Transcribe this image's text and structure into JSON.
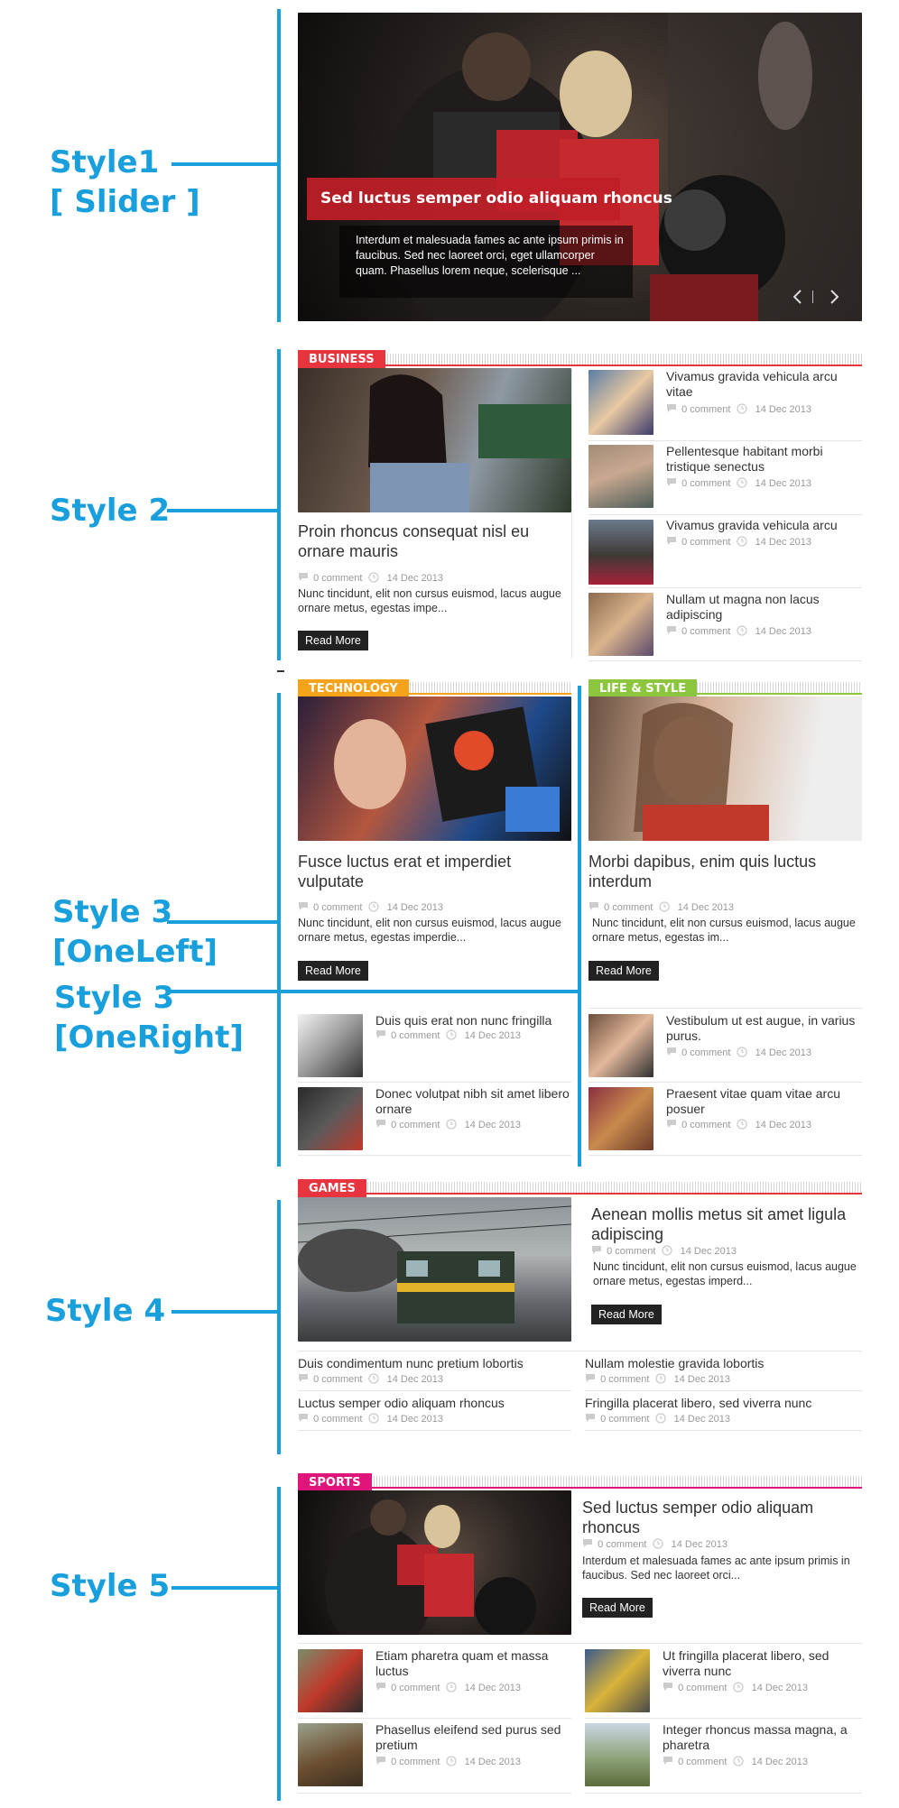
{
  "annotations": {
    "style1_line1": "Style1",
    "style1_line2": "[ Slider ]",
    "style2": "Style 2",
    "style3_left_1": "Style 3",
    "style3_left_2": "[OneLeft]",
    "style3_right_1": "Style 3",
    "style3_right_2": "[OneRight]",
    "style4": "Style 4",
    "style5": "Style 5"
  },
  "colors": {
    "annotation": "#19a0dc",
    "business": "#e8343f",
    "technology": "#f5a31a",
    "life_style": "#8cc63f",
    "games": "#e8343f",
    "sports": "#e0157b"
  },
  "slider": {
    "title": "Sed luctus semper odio aliquam rhoncus",
    "excerpt": "Interdum et malesuada fames ac ante ipsum primis in faucibus. Sed nec laoreet orci, eget ullamcorper quam. Phasellus lorem neque, scelerisque ...",
    "prev_icon": "chevron-left-icon",
    "next_icon": "chevron-right-icon"
  },
  "business": {
    "tag": "BUSINESS",
    "main": {
      "title": "Proin rhoncus consequat nisl eu ornare mauris",
      "comments": "0 comment",
      "date": "14 Dec 2013",
      "excerpt": "Nunc tincidunt, elit non cursus euismod, lacus augue ornare metus, egestas impe...",
      "read_more": "Read More"
    },
    "list": [
      {
        "title": "Vivamus gravida vehicula arcu vitae",
        "comments": "0 comment",
        "date": "14 Dec 2013"
      },
      {
        "title": "Pellentesque habitant morbi tristique senectus",
        "comments": "0 comment",
        "date": "14 Dec 2013"
      },
      {
        "title": "Vivamus gravida vehicula arcu",
        "comments": "0 comment",
        "date": "14 Dec 2013"
      },
      {
        "title": "Nullam ut magna non lacus adipiscing",
        "comments": "0 comment",
        "date": "14 Dec 2013"
      }
    ]
  },
  "technology": {
    "tag": "TECHNOLOGY",
    "main": {
      "title": "Fusce luctus erat et imperdiet vulputate",
      "comments": "0 comment",
      "date": "14 Dec 2013",
      "excerpt": "Nunc tincidunt, elit non cursus euismod, lacus augue ornare metus, egestas imperdie...",
      "read_more": "Read More"
    },
    "list": [
      {
        "title": "Duis quis erat non nunc fringilla",
        "comments": "0 comment",
        "date": "14 Dec 2013"
      },
      {
        "title": "Donec volutpat nibh sit amet libero ornare",
        "comments": "0 comment",
        "date": "14 Dec 2013"
      }
    ]
  },
  "life_style": {
    "tag": "LIFE & STYLE",
    "main": {
      "title": "Morbi dapibus, enim quis luctus interdum",
      "comments": "0 comment",
      "date": "14 Dec 2013",
      "excerpt": "Nunc tincidunt, elit non cursus euismod, lacus augue ornare metus, egestas im...",
      "read_more": "Read More"
    },
    "list": [
      {
        "title": "Vestibulum ut est augue, in varius purus.",
        "comments": "0 comment",
        "date": "14 Dec 2013"
      },
      {
        "title": "Praesent vitae quam vitae arcu posuer",
        "comments": "0 comment",
        "date": "14 Dec 2013"
      }
    ]
  },
  "games": {
    "tag": "GAMES",
    "main": {
      "title": "Aenean mollis metus sit amet ligula adipiscing",
      "comments": "0 comment",
      "date": "14 Dec 2013",
      "excerpt": "Nunc tincidunt, elit non cursus euismod, lacus augue ornare metus, egestas imperd...",
      "read_more": "Read More"
    },
    "list": [
      {
        "title": "Duis condimentum nunc pretium lobortis",
        "comments": "0 comment",
        "date": "14 Dec 2013"
      },
      {
        "title": "Nullam molestie gravida lobortis",
        "comments": "0 comment",
        "date": "14 Dec 2013"
      },
      {
        "title": "Luctus semper odio aliquam rhoncus",
        "comments": "0 comment",
        "date": "14 Dec 2013"
      },
      {
        "title": "Fringilla placerat libero, sed viverra nunc",
        "comments": "0 comment",
        "date": "14 Dec 2013"
      }
    ]
  },
  "sports": {
    "tag": "SPORTS",
    "main": {
      "title": "Sed luctus semper odio aliquam rhoncus",
      "comments": "0 comment",
      "date": "14 Dec 2013",
      "excerpt": "Interdum et malesuada fames ac ante ipsum primis in faucibus. Sed nec laoreet orci...",
      "read_more": "Read More"
    },
    "list": [
      {
        "title": "Etiam pharetra quam et massa luctus",
        "comments": "0 comment",
        "date": "14 Dec 2013"
      },
      {
        "title": "Ut fringilla placerat libero, sed viverra nunc",
        "comments": "0 comment",
        "date": "14 Dec 2013"
      },
      {
        "title": "Phasellus eleifend sed purus sed pretium",
        "comments": "0 comment",
        "date": "14 Dec 2013"
      },
      {
        "title": "Integer rhoncus massa magna, a pharetra",
        "comments": "0 comment",
        "date": "14 Dec 2013"
      }
    ]
  }
}
